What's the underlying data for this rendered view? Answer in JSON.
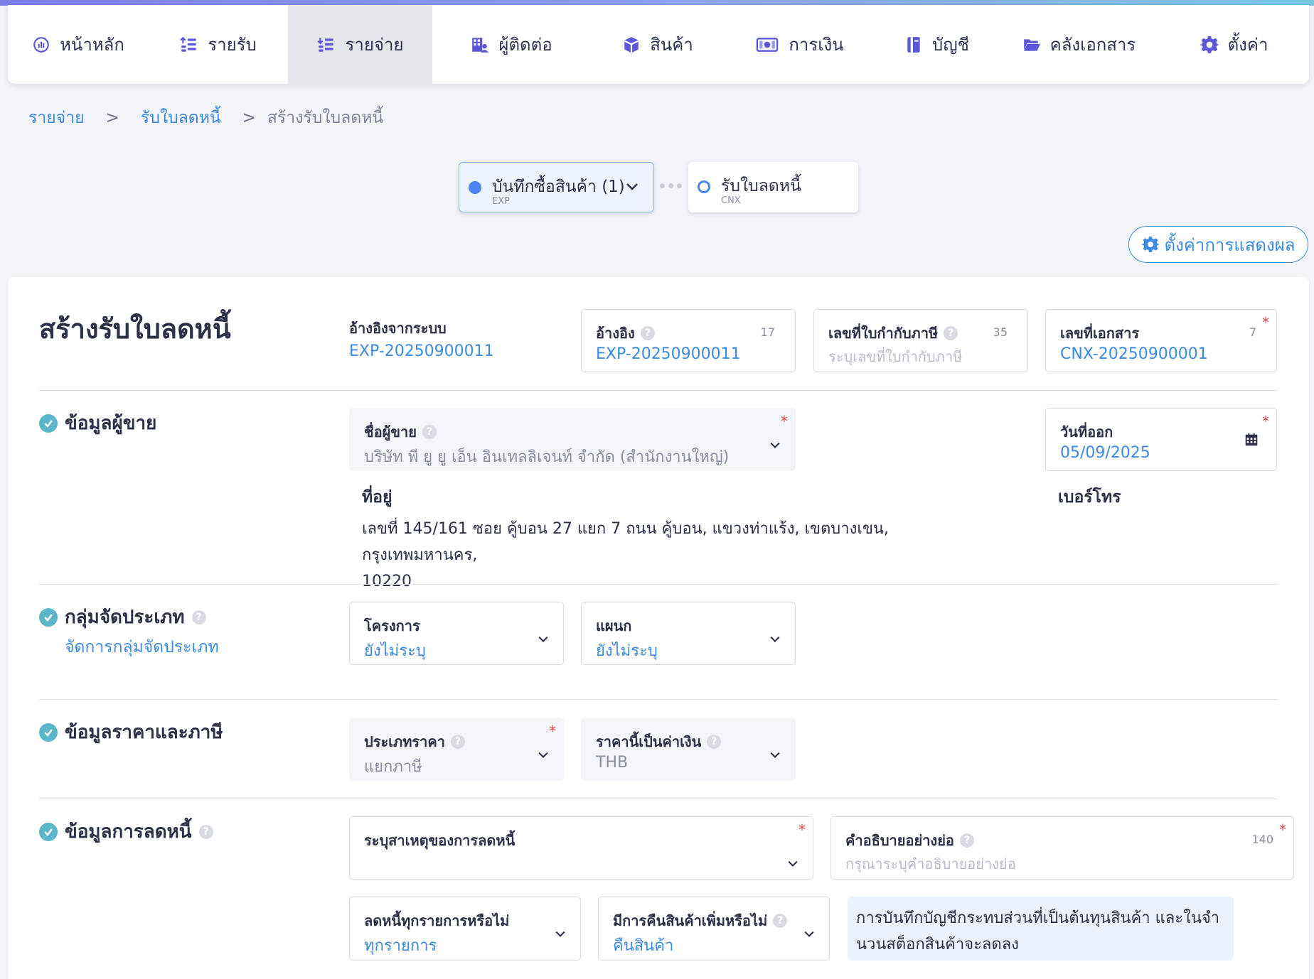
{
  "nav": {
    "items": [
      {
        "label": "หน้าหลัก",
        "icon": "dashboard-icon"
      },
      {
        "label": "รายรับ",
        "icon": "income-icon"
      },
      {
        "label": "รายจ่าย",
        "icon": "expense-icon",
        "active": true
      },
      {
        "label": "ผู้ติดต่อ",
        "icon": "contacts-icon"
      },
      {
        "label": "สินค้า",
        "icon": "box-icon"
      },
      {
        "label": "การเงิน",
        "icon": "money-icon"
      },
      {
        "label": "บัญชี",
        "icon": "ledger-icon"
      },
      {
        "label": "คลังเอกสาร",
        "icon": "folder-icon"
      },
      {
        "label": "ตั้งค่า",
        "icon": "gear-icon"
      }
    ]
  },
  "breadcrumb": {
    "level1": "รายจ่าย",
    "level2": "รับใบลดหนี้",
    "current": "สร้างรับใบลดหนี้",
    "separator": ">"
  },
  "stepper": {
    "step1": {
      "label": "บันทึกซื้อสินค้า (1)",
      "sub": "EXP"
    },
    "step2": {
      "label": "รับใบลดหนี้",
      "sub": "CNX"
    }
  },
  "display_settings_label": "ตั้งค่าการแสดงผล",
  "form": {
    "title": "สร้างรับใบลดหนี้",
    "system_ref": {
      "label": "อ้างอิงจากระบบ",
      "value": "EXP-20250900011"
    },
    "reference": {
      "label": "อ้างอิง",
      "value": "EXP-20250900011",
      "count": "17"
    },
    "tax_invoice_no": {
      "label": "เลขที่ใบกำกับภาษี",
      "placeholder": "ระบุเลขที่ใบกำกับภาษี",
      "count": "35"
    },
    "doc_no": {
      "label": "เลขที่เอกสาร",
      "value": "CNX-20250900001",
      "count": "7"
    },
    "seller_section": {
      "title": "ข้อมูลผู้ขาย",
      "seller_name": {
        "label": "ชื่อผู้ขาย",
        "value": "บริษัท พี ยู ยู เอ็น อินเทลลิเจนท์ จำกัด (สำนักงานใหญ่)"
      },
      "issue_date": {
        "label": "วันที่ออก",
        "value": "05/09/2025"
      },
      "address_label": "ที่อยู่",
      "address_line1": "เลขที่ 145/161 ซอย คู้บอน 27 แยก 7 ถนน คู้บอน, แขวงท่าแร้ง, เขตบางเขน, กรุงเทพมหานคร,",
      "address_line2": "10220",
      "phone_label": "เบอร์โทร"
    },
    "category_section": {
      "title": "กลุ่มจัดประเภท",
      "manage_link": "จัดการกลุ่มจัดประเภท",
      "project": {
        "label": "โครงการ",
        "value": "ยังไม่ระบุ"
      },
      "department": {
        "label": "แผนก",
        "value": "ยังไม่ระบุ"
      }
    },
    "price_section": {
      "title": "ข้อมูลราคาและภาษี",
      "price_type": {
        "label": "ประเภทราคา",
        "value": "แยกภาษี"
      },
      "currency": {
        "label": "ราคานี้เป็นค่าเงิน",
        "value": "THB"
      }
    },
    "debit_section": {
      "title": "ข้อมูลการลดหนี้",
      "reason": {
        "label": "ระบุสาเหตุของการลดหนี้",
        "value": ""
      },
      "description": {
        "label": "คำอธิบายอย่างย่อ",
        "placeholder": "กรุณาระบุคำอธิบายอย่างย่อ",
        "count": "140"
      },
      "all_items": {
        "label": "ลดหนี้ทุกรายการหรือไม่",
        "value": "ทุกรายการ"
      },
      "return_goods": {
        "label": "มีการคืนสินค้าเพิ่มหรือไม่",
        "value": "คืนสินค้า"
      },
      "info_line1": "การบันทึกบัญชีกระทบส่วนที่เป็นต้นทุนสินค้า และในจำ",
      "info_line2": "นวนสต็อกสินค้าจะลดลง"
    }
  },
  "colors": {
    "accent": "#3b8be6",
    "check": "#5ab6c8",
    "required": "#e04848"
  }
}
